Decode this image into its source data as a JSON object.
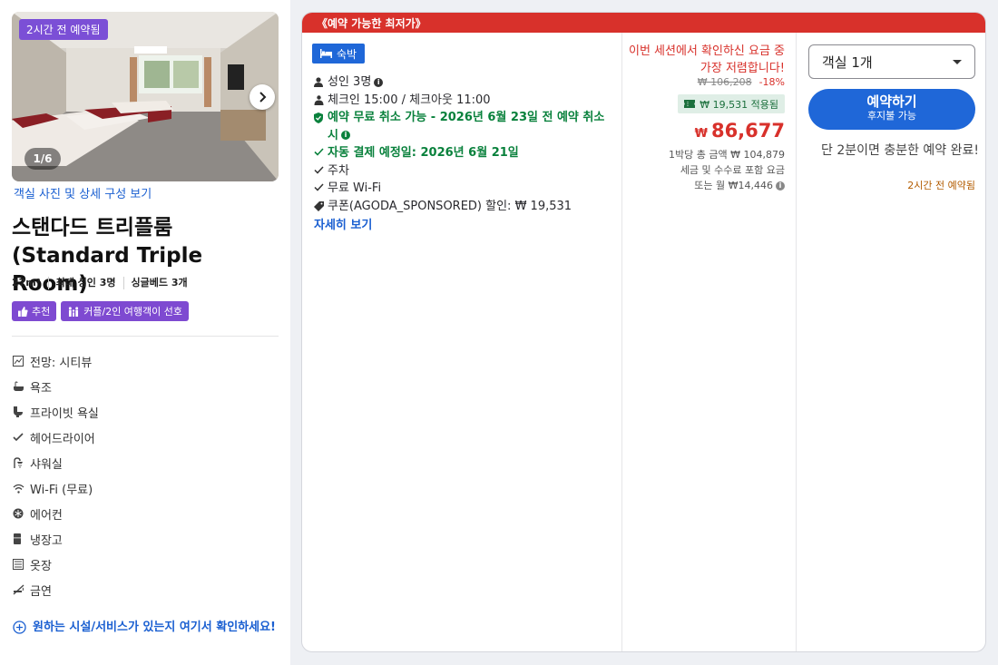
{
  "room": {
    "photo_badge": "2시간 전 예약됨",
    "photo_counter": "1/6",
    "photo_link": "객실 사진 및 상세 구성 보기",
    "title_ko": "스탠다드 트리플룸",
    "title_en": "(Standard Triple Room)",
    "specs": [
      "27m²",
      "최대 성인 3명",
      "싱글베드 3개"
    ],
    "tags": [
      {
        "icon": "thumbs-up-icon",
        "label": "추천"
      },
      {
        "icon": "family-icon",
        "label": "커플/2인 여행객이 선호"
      }
    ],
    "amenities": [
      {
        "icon": "view-icon",
        "label": "전망: 시티뷰"
      },
      {
        "icon": "bathtub-icon",
        "label": "욕조"
      },
      {
        "icon": "toilet-icon",
        "label": "프라이빗 욕실"
      },
      {
        "icon": "check-icon",
        "label": "헤어드라이어"
      },
      {
        "icon": "shower-icon",
        "label": "샤워실"
      },
      {
        "icon": "wifi-icon",
        "label": "Wi-Fi (무료)"
      },
      {
        "icon": "snowflake-icon",
        "label": "에어컨"
      },
      {
        "icon": "fridge-icon",
        "label": "냉장고"
      },
      {
        "icon": "wardrobe-icon",
        "label": "옷장"
      },
      {
        "icon": "no-smoking-icon",
        "label": "금연"
      }
    ],
    "facility_link": "원하는 시설/서비스가 있는지 여기서 확인하세요!"
  },
  "offer": {
    "banner": "《예약 가능한 최저가》",
    "stay_badge": "숙박",
    "features": {
      "guests": "성인 3명",
      "checkin": "체크인 15:00 / 체크아웃 11:00",
      "free_cancel": "예약 무료 취소 가능 - 2026년 6월 23일 전 예약 취소 시",
      "auto_pay": "자동 결제 예정일: 2026년 6월 21일",
      "parking": "주차",
      "wifi": "무료 Wi-Fi",
      "coupon": "쿠폰(AGODA_SPONSORED) 할인: ₩ 19,531",
      "more": "자세히 보기"
    },
    "price": {
      "cheapest_msg": "이번 세션에서 확인하신 요금 중 가장 저렴합니다!",
      "original": "₩ 106,208",
      "discount": "-18%",
      "coupon_applied": "₩ 19,531 적용됨",
      "currency": "₩",
      "amount": "86,677",
      "total": "1박당 총 금액 ₩ 104,879",
      "tax_note": "세금 및 수수료 포함 요금",
      "monthly": "또는 월 ₩14,446"
    },
    "booking": {
      "room_select": "객실 1개",
      "book_label": "예약하기",
      "book_sub": "후지불 가능",
      "hurry": "단 2분이면 충분한 예약 완료!",
      "recent": "2시간 전 예약됨"
    }
  },
  "colors": {
    "accent_blue": "#1f67d8",
    "banner_red": "#d8312b",
    "badge_purple": "#7b4fd6",
    "success_green": "#09813c"
  }
}
